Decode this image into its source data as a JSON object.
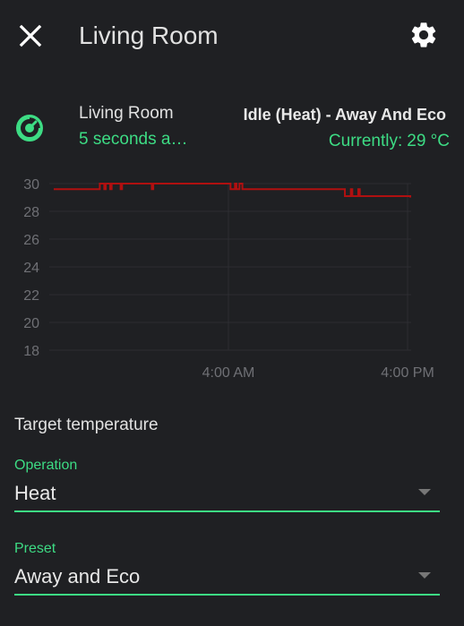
{
  "dialog": {
    "title": "Living Room",
    "close_icon": "close-icon",
    "settings_icon": "gear-icon"
  },
  "entity": {
    "icon": "thermostat-dial-icon",
    "name": "Living Room",
    "last_changed": "5 seconds a…",
    "state": "Idle (Heat) - Away And Eco",
    "current_label": "Currently:",
    "current_value": "29 °C"
  },
  "colors": {
    "accent": "#3ddc84",
    "series": "#b01010",
    "background": "#1f2023",
    "grid": "#2c2d31"
  },
  "chart_data": {
    "type": "line",
    "step": true,
    "y_ticks": [
      "30",
      "28",
      "26",
      "24",
      "22",
      "20",
      "18"
    ],
    "x_ticks": [
      "4:00 AM",
      "4:00 PM"
    ],
    "ylim": [
      18,
      30
    ],
    "grid": true,
    "series": [
      {
        "values": [
          [
            0,
            29.6
          ],
          [
            30,
            29.6
          ],
          [
            31,
            30.0
          ],
          [
            34,
            29.6
          ],
          [
            35,
            30.0
          ],
          [
            38,
            29.6
          ],
          [
            39,
            30.0
          ],
          [
            45,
            29.6
          ],
          [
            46,
            30.0
          ],
          [
            65,
            30.0
          ],
          [
            66,
            29.6
          ],
          [
            67,
            30.0
          ],
          [
            115,
            30.0
          ],
          [
            118,
            30.0
          ],
          [
            119,
            29.6
          ],
          [
            122,
            30.0
          ],
          [
            123,
            29.6
          ],
          [
            125,
            30.0
          ],
          [
            127,
            29.6
          ],
          [
            135,
            29.6
          ],
          [
            160,
            29.6
          ],
          [
            190,
            29.6
          ],
          [
            195,
            29.6
          ],
          [
            196,
            29.1
          ],
          [
            200,
            29.6
          ],
          [
            201,
            29.1
          ],
          [
            205,
            29.6
          ],
          [
            206,
            29.1
          ],
          [
            230,
            29.1
          ],
          [
            240,
            29.0
          ]
        ]
      }
    ]
  },
  "target": {
    "title": "Target temperature"
  },
  "operation": {
    "label": "Operation",
    "value": "Heat"
  },
  "preset": {
    "label": "Preset",
    "value": "Away and Eco"
  }
}
